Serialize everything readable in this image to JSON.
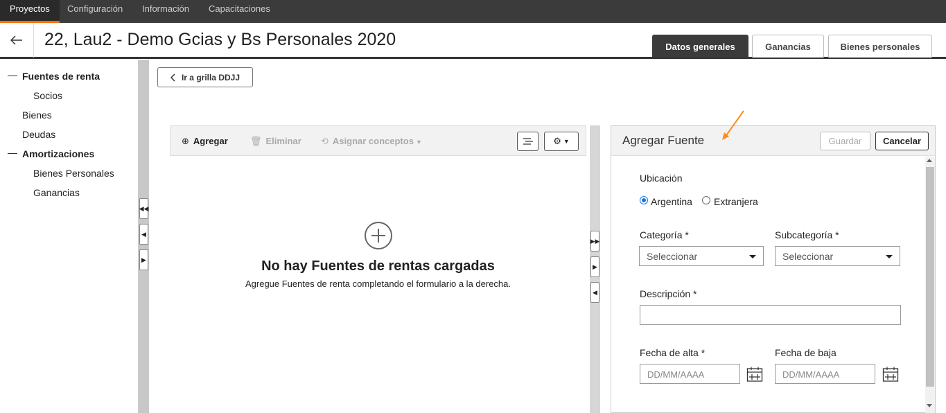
{
  "topnav": {
    "items": [
      {
        "label": "Proyectos"
      },
      {
        "label": "Configuración"
      },
      {
        "label": "Información"
      },
      {
        "label": "Capacitaciones"
      }
    ],
    "active_index": 0,
    "accent_color": "#ff6d00"
  },
  "header": {
    "back_icon": "arrow-left-icon",
    "title": "22, Lau2 - Demo Gcias y Bs Personales 2020",
    "tabs": [
      {
        "label": "Datos generales"
      },
      {
        "label": "Ganancias"
      },
      {
        "label": "Bienes personales"
      }
    ],
    "active_tab": 0
  },
  "sidebar": {
    "items": [
      {
        "label": "Fuentes de renta"
      },
      {
        "label": "Socios"
      },
      {
        "label": "Bienes"
      },
      {
        "label": "Deudas"
      },
      {
        "label": "Amortizaciones"
      },
      {
        "label": "Bienes Personales"
      },
      {
        "label": "Ganancias"
      }
    ]
  },
  "main": {
    "back_grid_label": "Ir a grilla DDJJ",
    "toolbar": {
      "add_label": "Agregar",
      "delete_label": "Eliminar",
      "assign_label": "Asignar conceptos"
    },
    "empty": {
      "title": "No hay Fuentes de rentas cargadas",
      "subtitle": "Agregue Fuentes de renta completando el formulario a la derecha."
    }
  },
  "form": {
    "title": "Agregar Fuente",
    "save_label": "Guardar",
    "cancel_label": "Cancelar",
    "location_label": "Ubicación",
    "location_options": [
      {
        "label": "Argentina",
        "selected": true
      },
      {
        "label": "Extranjera",
        "selected": false
      }
    ],
    "category_label": "Categoría *",
    "category_value": "Seleccionar",
    "subcategory_label": "Subcategoría *",
    "subcategory_value": "Seleccionar",
    "description_label": "Descripción *",
    "description_value": "",
    "start_date_label": "Fecha de alta *",
    "start_date_placeholder": "DD/MM/AAAA",
    "end_date_label": "Fecha de baja",
    "end_date_placeholder": "DD/MM/AAAA"
  }
}
